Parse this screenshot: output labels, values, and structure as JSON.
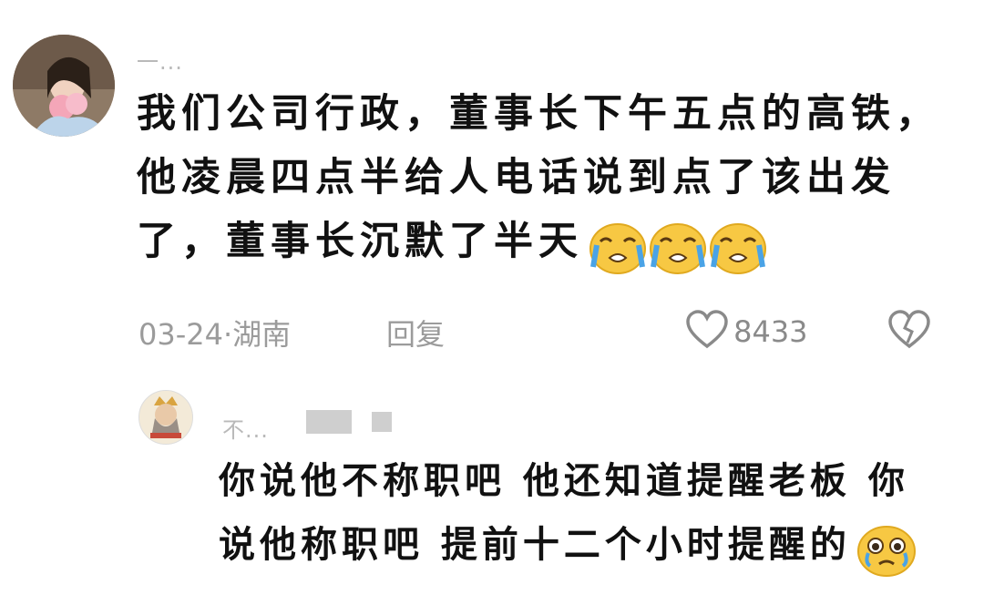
{
  "comment": {
    "username": "一...",
    "lines": [
      "我们公司行政，董事长下午五点的高铁，",
      "他凌晨四点半给人电话说到点了该出发",
      "了，董事长沉默了半天"
    ],
    "emoji_name": "crying-face-icon",
    "date": "03-24",
    "dot": "·",
    "location": "湖南",
    "reply_label": "回复",
    "like_count": "8433"
  },
  "reply": {
    "username": "不...",
    "lines": [
      "你说他不称职吧 他还知道提醒老板 你",
      "说他称职吧 提前十二个小时提醒的"
    ],
    "emoji_name": "teary-face-icon"
  },
  "colors": {
    "text": "#111111",
    "meta": "#9b9b9b",
    "username": "#b9b9b9",
    "emoji_yellow": "#f7c843",
    "emoji_tear": "#4aa3e6"
  }
}
